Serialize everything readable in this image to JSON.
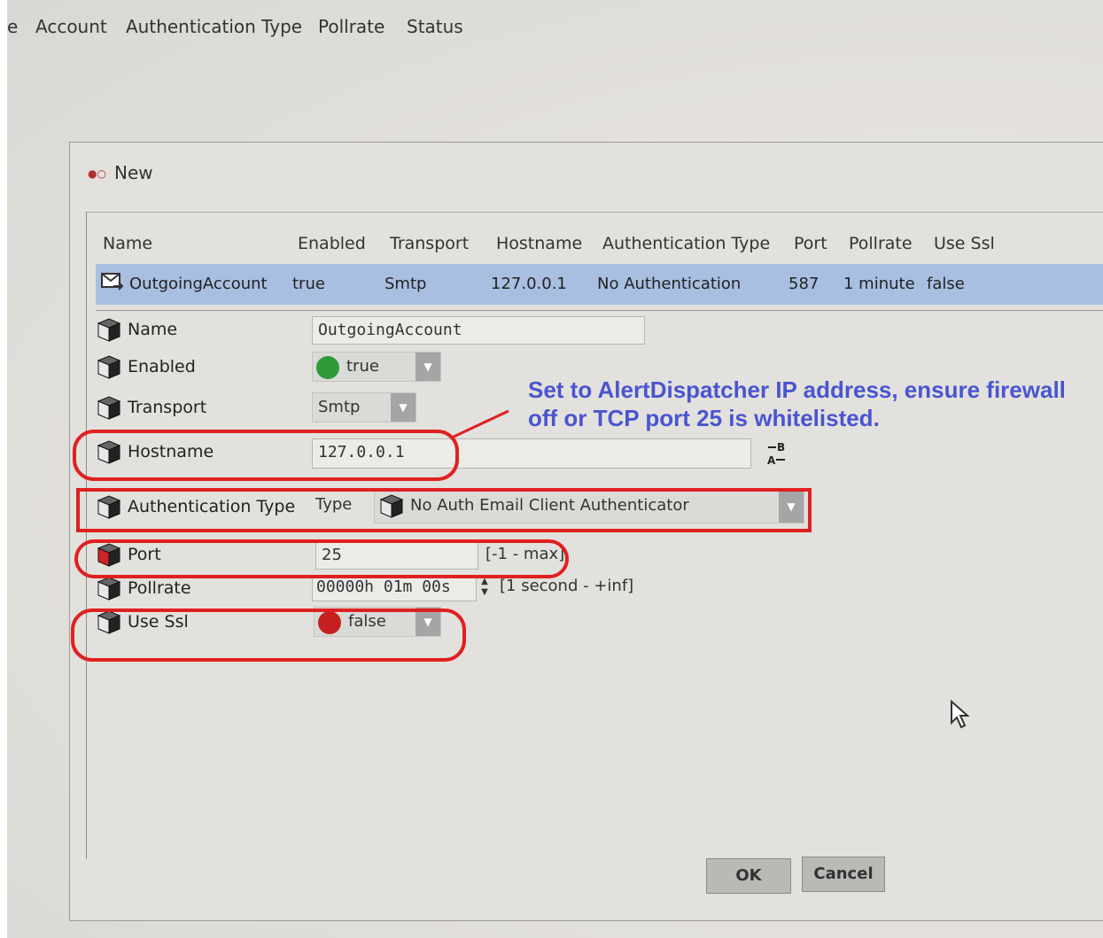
{
  "top_columns": [
    "e",
    "Account",
    "Authentication Type",
    "Pollrate",
    "Status"
  ],
  "dialog": {
    "title": "New",
    "table": {
      "headers": [
        "Name",
        "Enabled",
        "Transport",
        "Hostname",
        "Authentication Type",
        "Port",
        "Pollrate",
        "Use Ssl"
      ],
      "row": [
        "OutgoingAccount",
        "true",
        "Smtp",
        "127.0.0.1",
        "No Authentication",
        "587",
        "1 minute",
        "false"
      ]
    },
    "props": {
      "name": {
        "label": "Name",
        "value": "OutgoingAccount"
      },
      "enabled": {
        "label": "Enabled",
        "value": "true"
      },
      "transport": {
        "label": "Transport",
        "value": "Smtp"
      },
      "hostname": {
        "label": "Hostname",
        "value": "127.0.0.1"
      },
      "auth_type": {
        "label": "Authentication Type",
        "type_label": "Type",
        "value": "No Auth Email Client Authenticator"
      },
      "port": {
        "label": "Port",
        "value": "25",
        "range": "[-1 - max]"
      },
      "pollrate": {
        "label": "Pollrate",
        "value": "00000h 01m 00s",
        "range": "[1 second - +inf]"
      },
      "use_ssl": {
        "label": "Use Ssl",
        "value": "false"
      }
    },
    "buttons": {
      "ok": "OK",
      "cancel": "Cancel"
    }
  },
  "annotation": {
    "line1": "Set to AlertDispatcher IP address, ensure firewall",
    "line2": "off or TCP port 25 is whitelisted."
  },
  "colors": {
    "annotation": "#4a55d0",
    "highlight": "#e02020",
    "enabled_dot": "#2e9a3a",
    "disabled_dot": "#c42020",
    "selected_row": "#a9bfe2"
  }
}
